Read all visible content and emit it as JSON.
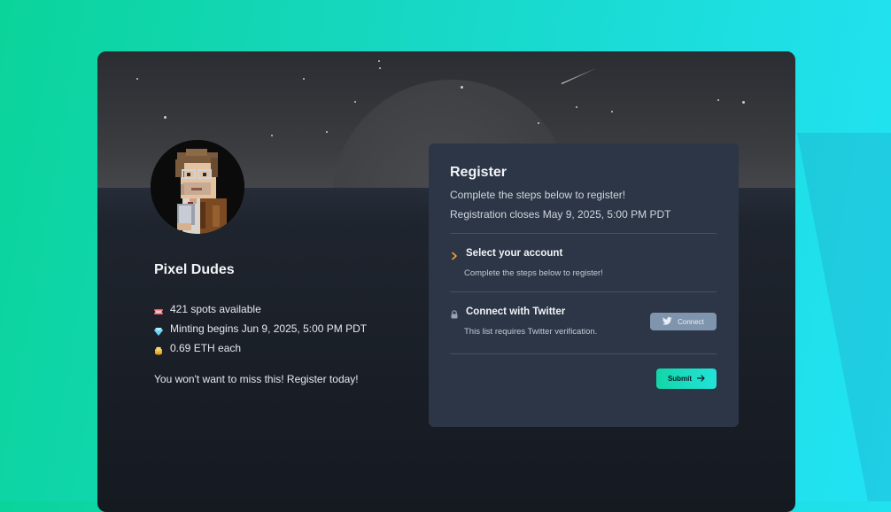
{
  "collection": {
    "name": "Pixel Dudes",
    "stats": [
      {
        "icon": "ticket-icon",
        "text": "421 spots available"
      },
      {
        "icon": "gem-icon",
        "text": "Minting begins Jun 9, 2025, 5:00 PM PDT"
      },
      {
        "icon": "coins-icon",
        "text": "0.69 ETH each"
      }
    ],
    "tagline": "You won't want to miss this! Register today!"
  },
  "register": {
    "title": "Register",
    "subtitle": "Complete the steps below to register!",
    "closes": "Registration closes May 9, 2025, 5:00 PM PDT",
    "steps": [
      {
        "icon": "chevron-right-icon",
        "title": "Select your account",
        "description": "Complete the steps below to register!"
      },
      {
        "icon": "lock-icon",
        "title": "Connect with Twitter",
        "description": "This list requires Twitter verification.",
        "button_label": "Connect"
      }
    ],
    "submit_label": "Submit"
  },
  "colors": {
    "accent": "#f5a623",
    "submit": "#1ddcc0",
    "connect": "#7f95ad",
    "panel": "#2d3646"
  }
}
